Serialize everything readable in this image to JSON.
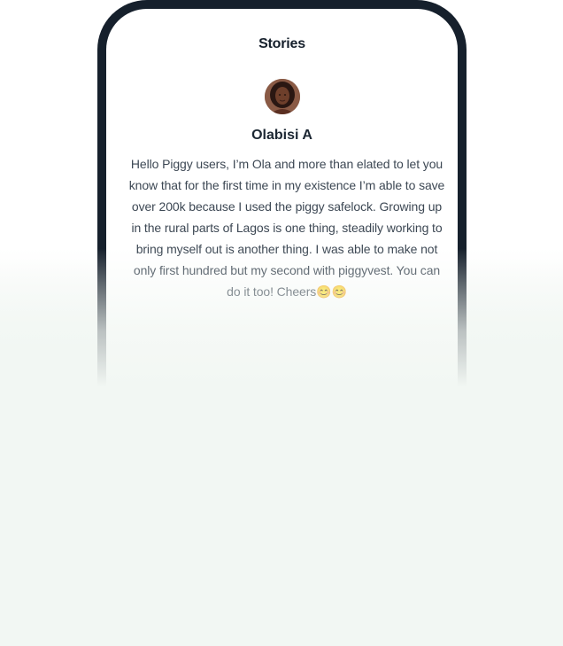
{
  "screen": {
    "title": "Stories"
  },
  "story": {
    "author_name": "Olabisi A",
    "text": "Hello Piggy users, I’m Ola and more than elated to let you know that for the first time in my existence I’m able to save over 200k because I used the piggy safelock. Growing up in the rural parts of Lagos is one thing, steadily working to bring myself out is another thing. I was able to make not only first hundred but my second with piggyvest. You can do it too! Cheers😊😊",
    "avatar": "author-avatar-photo"
  },
  "colors": {
    "frame": "#16202c",
    "background": "#f2f7f3",
    "title": "#16202c",
    "body_text": "#3d4854"
  }
}
